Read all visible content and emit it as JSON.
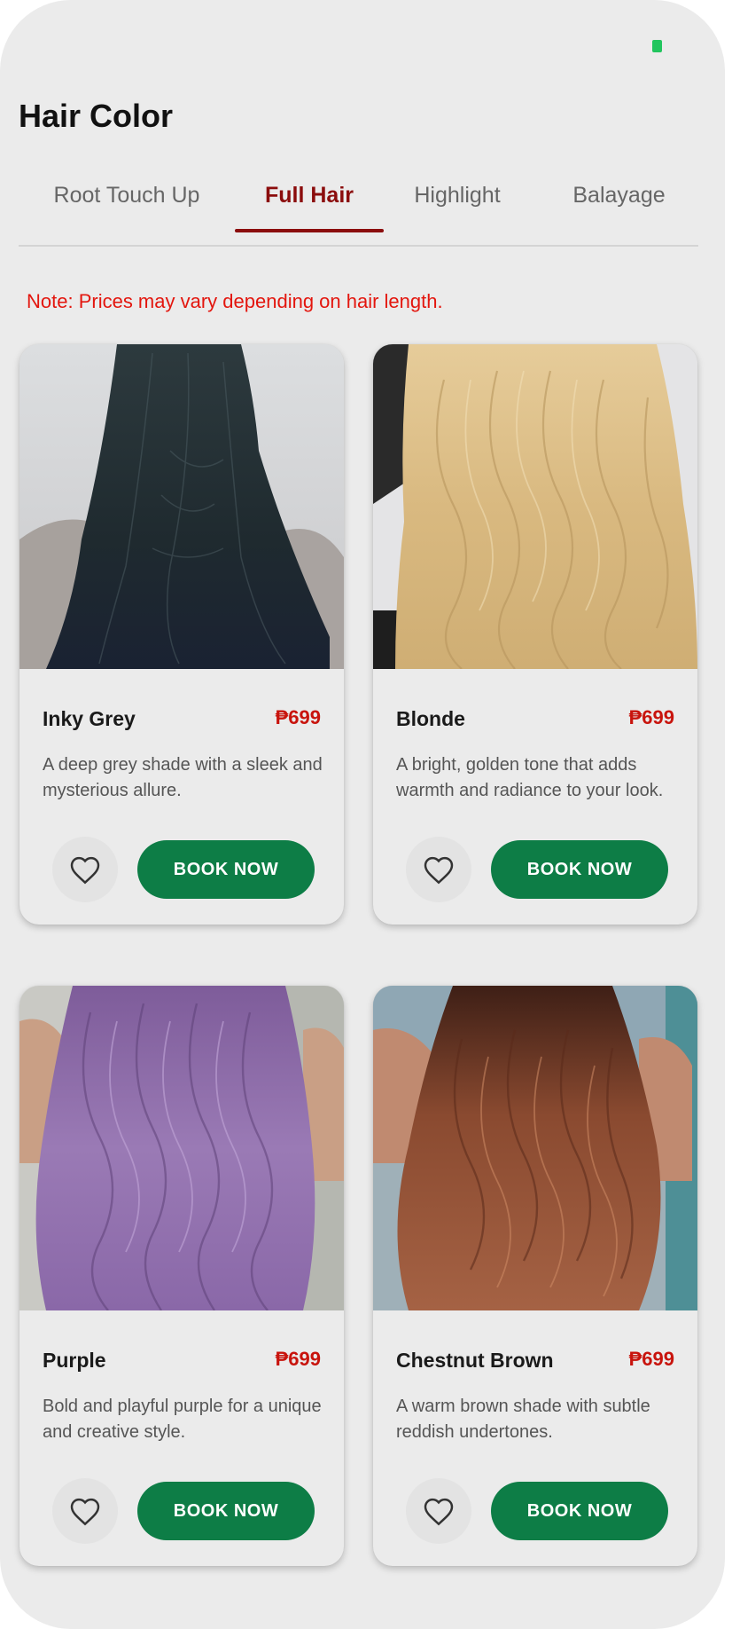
{
  "header": {
    "title": "Hair Color"
  },
  "tabs": [
    {
      "label": "Root Touch Up",
      "active": false
    },
    {
      "label": "Full Hair",
      "active": true
    },
    {
      "label": "Highlight",
      "active": false
    },
    {
      "label": "Balayage",
      "active": false
    }
  ],
  "note": "Note: Prices may vary depending on hair length.",
  "colors": {
    "accent": "#8b0d0d",
    "price": "#c8140d",
    "button": "#0d7d46",
    "note": "#e3160e",
    "status_dot": "#22c55e"
  },
  "cards": [
    {
      "name": "Inky Grey",
      "price": "₱699",
      "description": "A deep grey shade with a sleek and mysterious allure.",
      "button_label": "BOOK NOW",
      "icon": "heart-outline-icon"
    },
    {
      "name": "Blonde",
      "price": "₱699",
      "description": "A bright, golden tone that adds warmth and radiance to your look.",
      "button_label": "BOOK NOW",
      "icon": "heart-outline-icon"
    },
    {
      "name": "Purple",
      "price": "₱699",
      "description": "Bold and playful purple for a unique and creative style.",
      "button_label": "BOOK NOW",
      "icon": "heart-outline-icon"
    },
    {
      "name": "Chestnut Brown",
      "price": "₱699",
      "description": "A warm brown shade with subtle reddish undertones.",
      "button_label": "BOOK NOW",
      "icon": "heart-outline-icon"
    }
  ]
}
